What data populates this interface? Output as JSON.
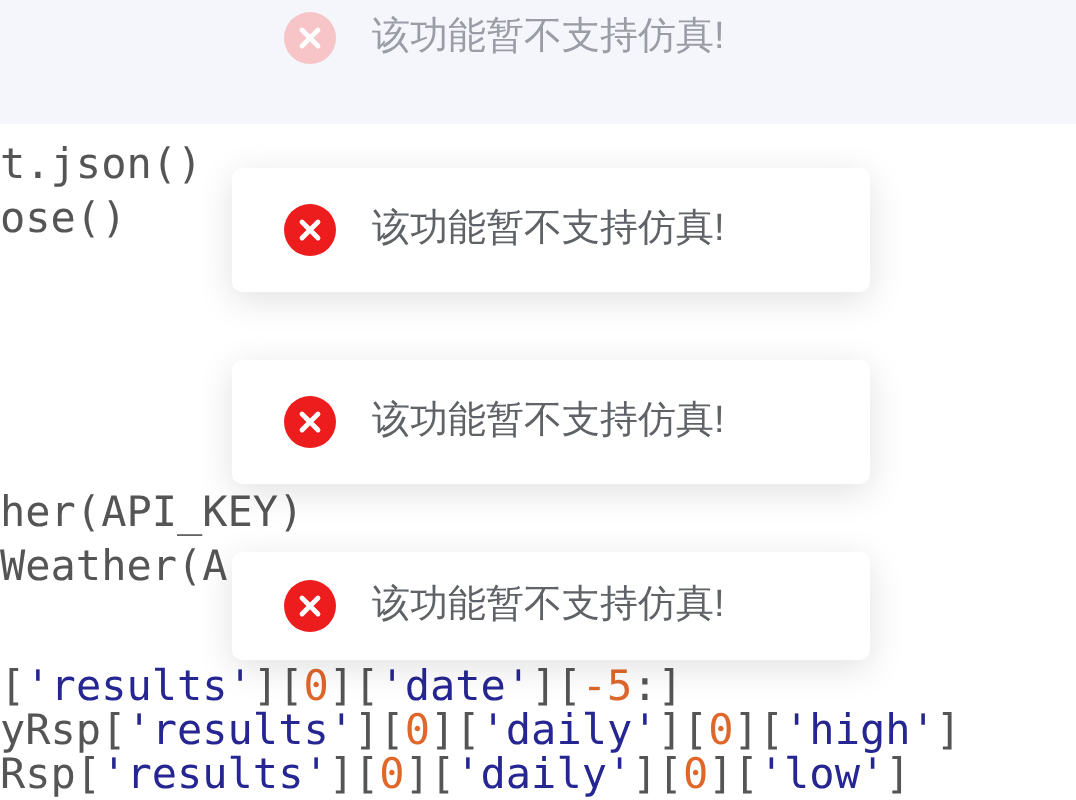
{
  "code_blocks": [
    [
      [
        {
          "text": "t.json()",
          "kind": "plain"
        }
      ],
      [
        {
          "text": "ose()",
          "kind": "plain"
        }
      ]
    ],
    [
      [
        {
          "text": "her(API_KEY)",
          "kind": "plain"
        }
      ],
      [
        {
          "text": "Weather(A",
          "kind": "plain"
        }
      ]
    ],
    [
      [
        {
          "text": "[",
          "kind": "plain"
        },
        {
          "text": "'results'",
          "kind": "string"
        },
        {
          "text": "][",
          "kind": "plain"
        },
        {
          "text": "0",
          "kind": "number"
        },
        {
          "text": "][",
          "kind": "plain"
        },
        {
          "text": "'date'",
          "kind": "string"
        },
        {
          "text": "][",
          "kind": "plain"
        },
        {
          "text": "-5",
          "kind": "number"
        },
        {
          "text": ":]",
          "kind": "plain"
        }
      ],
      [
        {
          "text": "yRsp[",
          "kind": "plain"
        },
        {
          "text": "'results'",
          "kind": "string"
        },
        {
          "text": "][",
          "kind": "plain"
        },
        {
          "text": "0",
          "kind": "number"
        },
        {
          "text": "][",
          "kind": "plain"
        },
        {
          "text": "'daily'",
          "kind": "string"
        },
        {
          "text": "][",
          "kind": "plain"
        },
        {
          "text": "0",
          "kind": "number"
        },
        {
          "text": "][",
          "kind": "plain"
        },
        {
          "text": "'high'",
          "kind": "string"
        },
        {
          "text": "]",
          "kind": "plain"
        }
      ],
      [
        {
          "text": "Rsp[",
          "kind": "plain"
        },
        {
          "text": "'results'",
          "kind": "string"
        },
        {
          "text": "][",
          "kind": "plain"
        },
        {
          "text": "0",
          "kind": "number"
        },
        {
          "text": "][",
          "kind": "plain"
        },
        {
          "text": "'daily'",
          "kind": "string"
        },
        {
          "text": "][",
          "kind": "plain"
        },
        {
          "text": "0",
          "kind": "number"
        },
        {
          "text": "][",
          "kind": "plain"
        },
        {
          "text": "'low'",
          "kind": "string"
        },
        {
          "text": "]",
          "kind": "plain"
        }
      ]
    ]
  ],
  "toasts": [
    {
      "message": "该功能暂不支持仿真!",
      "faded": true
    },
    {
      "message": "该功能暂不支持仿真!",
      "faded": false
    },
    {
      "message": "该功能暂不支持仿真!",
      "faded": false
    },
    {
      "message": "该功能暂不支持仿真!",
      "faded": false
    }
  ]
}
